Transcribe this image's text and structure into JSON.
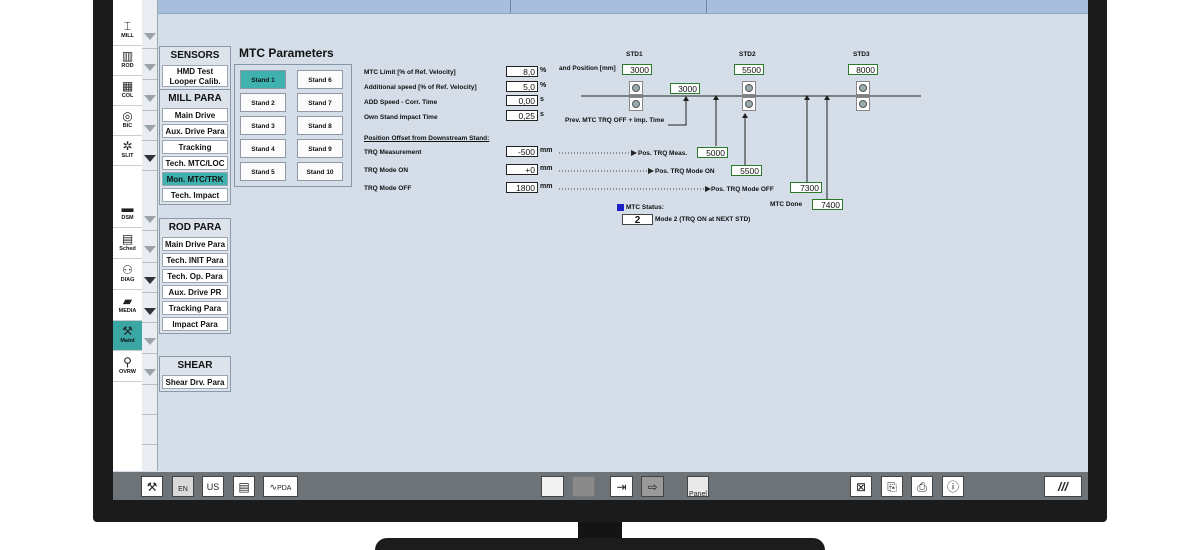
{
  "page_title": "MTC Parameters",
  "nav": [
    {
      "label": "MILL",
      "icon": "mill-icon",
      "glyph": "⌶"
    },
    {
      "label": "ROD",
      "icon": "rod-icon",
      "glyph": "▥"
    },
    {
      "label": "COL",
      "icon": "coil-icon",
      "glyph": "▦"
    },
    {
      "label": "BIC",
      "icon": "bic-icon",
      "glyph": "◎"
    },
    {
      "label": "SLIT",
      "icon": "slit-icon",
      "glyph": "✲"
    },
    {
      "label": "DSM",
      "icon": "dsm-icon",
      "glyph": "▬"
    },
    {
      "label": "Sched",
      "icon": "schedule-icon",
      "glyph": "▤"
    },
    {
      "label": "DIAG",
      "icon": "diagnostics-icon",
      "glyph": "⚇"
    },
    {
      "label": "MEDIA",
      "icon": "media-icon",
      "glyph": "▰"
    },
    {
      "label": "Maint",
      "icon": "maintenance-icon",
      "glyph": "⚒"
    },
    {
      "label": "OVRW",
      "icon": "overview-icon",
      "glyph": "⚲"
    }
  ],
  "sensors": {
    "title": "SENSORS",
    "items": [
      "HMD Test",
      "Looper Calib."
    ]
  },
  "mill_para": {
    "title": "MILL PARA",
    "items": [
      "Main Drive",
      "Aux. Drive Para",
      "Tracking",
      "Tech. MTC/LOC",
      "Mon. MTC/TRK",
      "Tech. Impact"
    ]
  },
  "rod_para": {
    "title": "ROD PARA",
    "items": [
      "Main Drive Para",
      "Tech. INIT Para",
      "Tech. Op. Para",
      "Aux. Drive PR",
      "Tracking Para",
      "Impact Para"
    ]
  },
  "shear": {
    "title": "SHEAR",
    "items": [
      "Shear Drv. Para"
    ]
  },
  "stands": [
    "Stand 1",
    "Stand 2",
    "Stand 3",
    "Stand 4",
    "Stand 5",
    "Stand 6",
    "Stand 7",
    "Stand 8",
    "Stand 9",
    "Stand 10"
  ],
  "params": {
    "mtc_limit_label": "MTC Limit [% of Ref. Velocity]",
    "mtc_limit_value": "8,0",
    "mtc_limit_unit": "%",
    "add_speed_label": "Additional speed [% of Ref. Velocity]",
    "add_speed_value": "5,0",
    "add_speed_unit": "%",
    "corr_time_label": "ADD Speed - Corr. Time",
    "corr_time_value": "0,00",
    "corr_time_unit": "s",
    "impact_time_label": "Own Stand Impact Time",
    "impact_time_value": "0,25",
    "impact_time_unit": "s",
    "offset_header": "Position Offset from Downstream Stand:",
    "trq_meas_label": "TRQ Measurement",
    "trq_meas_value": "-500",
    "trq_meas_unit": "mm",
    "trq_on_label": "TRQ Mode ON",
    "trq_on_value": "+0",
    "trq_on_unit": "mm",
    "trq_off_label": "TRQ Mode OFF",
    "trq_off_value": "1800",
    "trq_off_unit": "mm"
  },
  "diagram": {
    "std1": "STD1",
    "std2": "STD2",
    "std3": "STD3",
    "and_position": "and Position [mm]",
    "std1_pos": "3000",
    "std2_pos": "5500",
    "std3_pos": "8000",
    "mid_pos": "3000",
    "prev_mtc": "Prev. MTC TRQ OFF + Imp. Time",
    "pos_trq_meas_label": "Pos. TRQ Meas.",
    "pos_trq_meas_value": "5000",
    "pos_trq_on_label": "Pos. TRQ Mode ON",
    "pos_trq_on_value": "5500",
    "pos_trq_off_label": "Pos. TRQ Mode  OFF",
    "pos_trq_off_value": "7300",
    "mtc_done_label": "MTC Done",
    "mtc_done_value": "7400",
    "mtc_status_label": "MTC Status:",
    "mtc_status_value": "2",
    "mtc_status_text": "Mode 2 (TRQ ON at NEXT STD)"
  },
  "taskbar": {
    "lang_en": "EN",
    "lang_us": "US",
    "pda": "PDA",
    "panel": "Panel"
  },
  "colors": {
    "screen_bg": "#d4dde8",
    "selected": "#3fb2b0",
    "taskbar": "#6e7378"
  }
}
